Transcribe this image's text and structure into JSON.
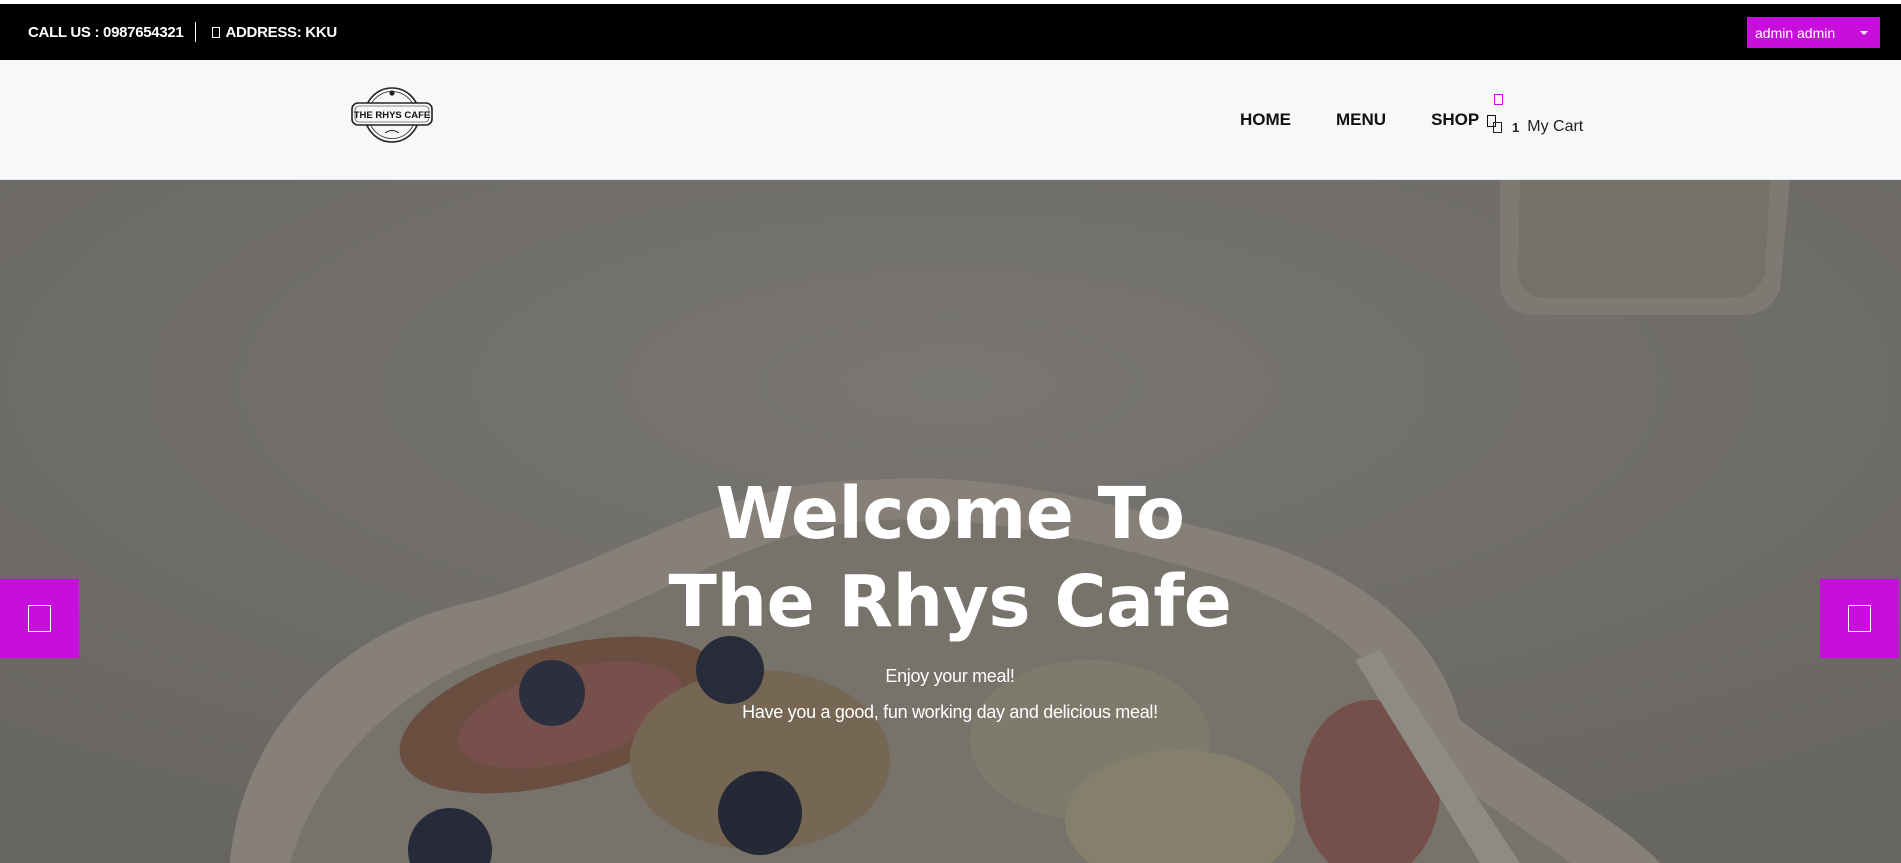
{
  "topbar": {
    "phone": "CALL US : 0987654321",
    "address": "ADDRESS: KKU",
    "account_label": "admin admin"
  },
  "header": {
    "logo_text": "THE RHYS CAFE",
    "nav": {
      "home": "HOME",
      "menu": "MENU",
      "shop": "SHOP"
    },
    "cart": {
      "count": "1",
      "label": "My Cart"
    }
  },
  "hero": {
    "title_line1": "Welcome To",
    "title_line2": "The Rhys Cafe",
    "subtitle_line1": "Enjoy your meal!",
    "subtitle_line2": "Have you a good, fun working day and delicious meal!"
  },
  "colors": {
    "accent": "#c70edb",
    "topbar_bg": "#000000",
    "header_bg": "#f7f8fa"
  },
  "icons": {
    "address": "location-icon",
    "shop": "chevron-down-icon",
    "cart": "cart-icon",
    "prev": "arrow-left-icon",
    "next": "arrow-right-icon"
  }
}
